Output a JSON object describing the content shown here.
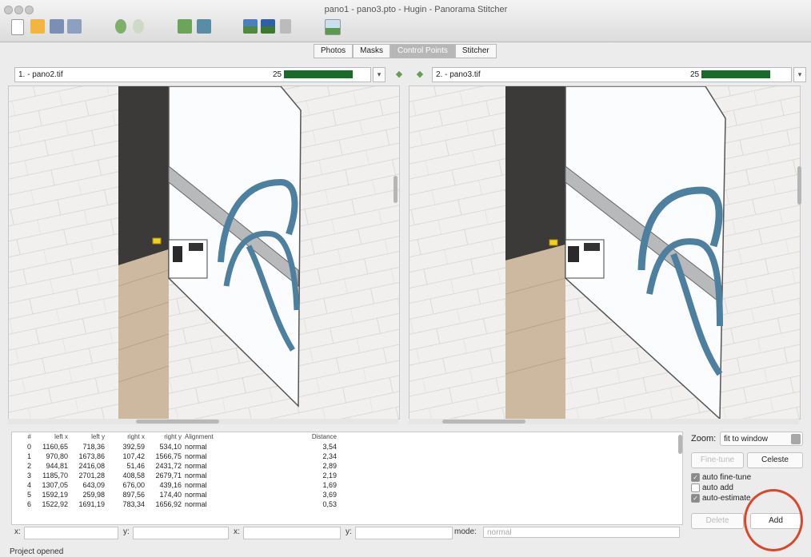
{
  "window": {
    "title": "pano1 - pano3.pto - Hugin - Panorama Stitcher"
  },
  "toolbar": {
    "icons": [
      "new-file-icon",
      "open-file-icon",
      "save-icon",
      "save-as-icon",
      "undo-icon",
      "redo-icon",
      "copy-icon",
      "image-icon",
      "panorama-preview-icon",
      "fast-preview-icon",
      "layout-icon",
      "gl-preview-icon"
    ]
  },
  "tabs": [
    "Photos",
    "Masks",
    "Control Points",
    "Stitcher"
  ],
  "tab_active": "Control Points",
  "left_image": {
    "label": "1. - pano2.tif",
    "count": "25",
    "fill": 0.95
  },
  "right_image": {
    "label": "2. - pano3.tif",
    "count": "25",
    "fill": 0.95
  },
  "table": {
    "headers": [
      "#",
      "left x",
      "left y",
      "right x",
      "right y",
      "Alignment",
      "Distance"
    ],
    "rows": [
      [
        "0",
        "1160,65",
        "718,36",
        "392,59",
        "534,10",
        "normal",
        "3,54"
      ],
      [
        "1",
        "970,80",
        "1673,86",
        "107,42",
        "1566,75",
        "normal",
        "2,34"
      ],
      [
        "2",
        "944,81",
        "2416,08",
        "51,46",
        "2431,72",
        "normal",
        "2,89"
      ],
      [
        "3",
        "1185,70",
        "2701,28",
        "408,58",
        "2679,71",
        "normal",
        "2,19"
      ],
      [
        "4",
        "1307,05",
        "643,09",
        "676,00",
        "439,16",
        "normal",
        "1,69"
      ],
      [
        "5",
        "1592,19",
        "259,98",
        "897,56",
        "174,40",
        "normal",
        "3,69"
      ],
      [
        "6",
        "1522,92",
        "1691,19",
        "783,34",
        "1656,92",
        "normal",
        "0,53"
      ]
    ]
  },
  "fields": {
    "x_label": "x:",
    "y_label": "y:",
    "x2_label": "x:",
    "y2_label": "y:",
    "mode_label": "mode:",
    "mode_value": "normal"
  },
  "controls": {
    "zoom_label": "Zoom:",
    "zoom_value": "fit to window",
    "finetune": "Fine-tune",
    "celeste": "Celeste",
    "auto_finetune": "auto fine-tune",
    "auto_finetune_checked": true,
    "auto_add": "auto add",
    "auto_add_checked": false,
    "auto_estimate": "auto-estimate",
    "auto_estimate_checked": true,
    "delete": "Delete",
    "add": "Add"
  },
  "status": "Project opened",
  "colors": {
    "progress": "#1a6b2a",
    "highlight_circle": "#d9482b",
    "marker": "#f3d21e"
  }
}
